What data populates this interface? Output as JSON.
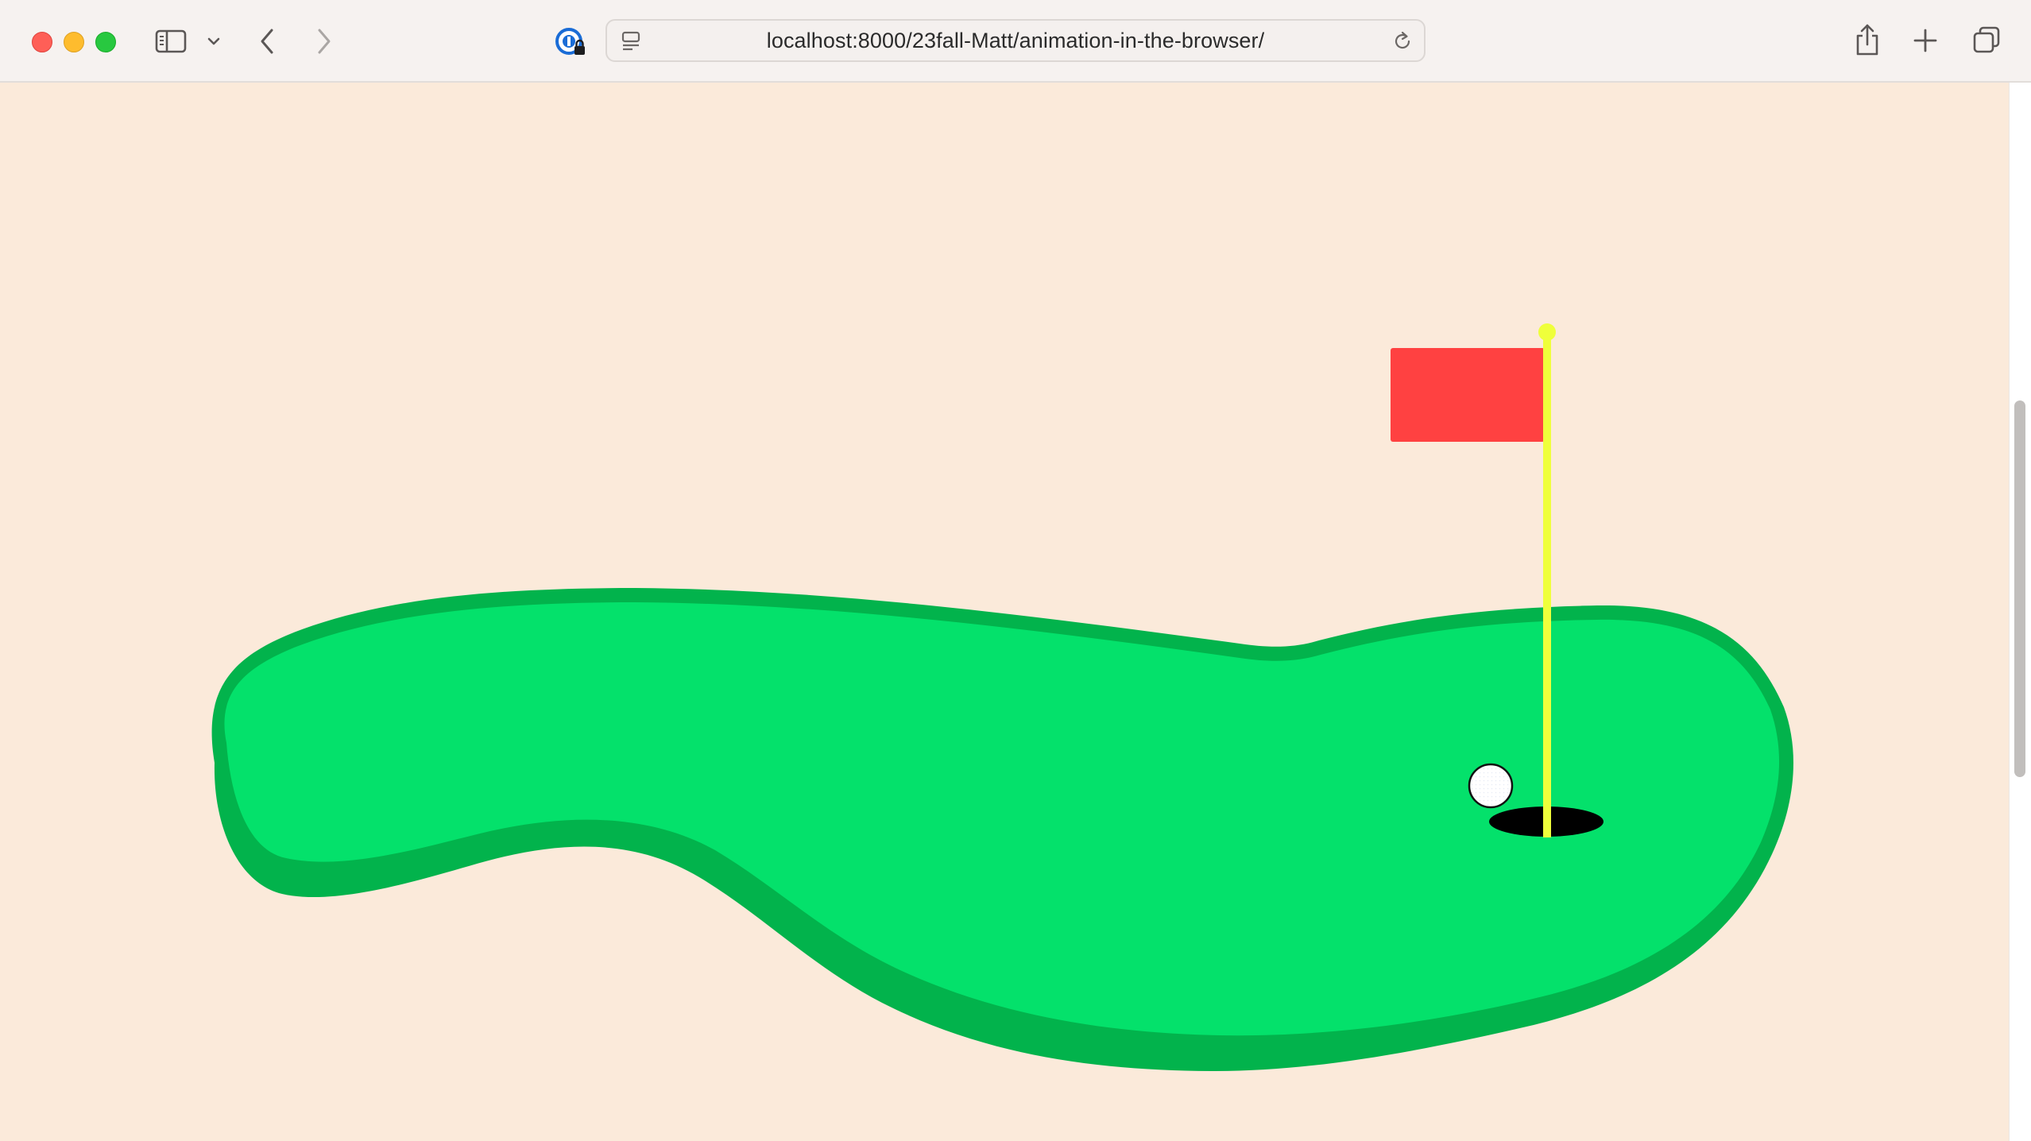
{
  "browser": {
    "url": "localhost:8000/23fall-Matt/animation-in-the-browser/",
    "icons": {
      "sidebar": "sidebar-icon",
      "tab_groups": "chevron-down-icon",
      "back": "chevron-left-icon",
      "forward": "chevron-right-icon",
      "password_manager": "password-manager-icon",
      "reader": "page-menu-icon",
      "reload": "reload-icon",
      "share": "share-icon",
      "new_tab": "plus-icon",
      "tab_overview": "tab-overview-icon"
    }
  },
  "scene": {
    "background_color": "#fbeada",
    "green_color": "#04e16b",
    "green_edge_color": "#02b34c",
    "flag_color": "#ff4141",
    "pole_color": "#efff3b",
    "hole_color": "#000000",
    "ball_color": "#ffffff"
  }
}
